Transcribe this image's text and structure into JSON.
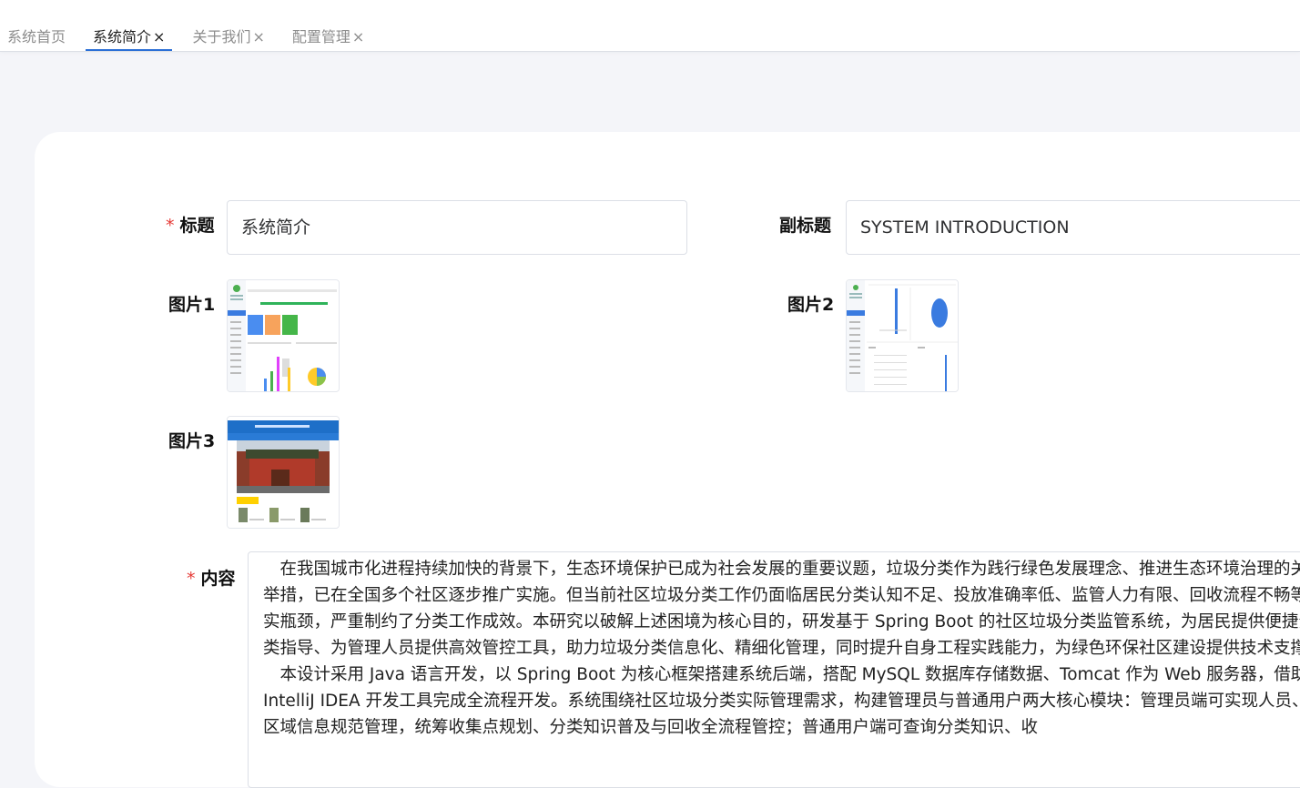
{
  "tabs": [
    {
      "label": "系统首页",
      "close": ""
    },
    {
      "label": "系统简介",
      "close": "×"
    },
    {
      "label": "关于我们",
      "close": "×"
    },
    {
      "label": "配置管理",
      "close": "×"
    }
  ],
  "form": {
    "required_mark": "*",
    "title_label": "标题",
    "title_value": "系统简介",
    "subtitle_label": "副标题",
    "subtitle_value": "SYSTEM INTRODUCTION",
    "image1_label": "图片1",
    "image2_label": "图片2",
    "image3_label": "图片3",
    "content_label": "内容",
    "content_paragraphs": [
      "在我国城市化进程持续加快的背景下，生态环境保护已成为社会发展的重要议题，垃圾分类作为践行绿色发展理念、推进生态环境治理的关键举措，已在全国多个社区逐步推广实施。但当前社区垃圾分类工作仍面临居民分类认知不足、投放准确率低、监管人力有限、回收流程不畅等现实瓶颈，严重制约了分类工作成效。本研究以破解上述困境为核心目的，研发基于 Spring Boot 的社区垃圾分类监管系统，为居民提供便捷分类指导、为管理人员提供高效管控工具，助力垃圾分类信息化、精细化管理，同时提升自身工程实践能力，为绿色环保社区建设提供技术支撑。",
      "本设计采用 Java 语言开发，以 Spring Boot 为核心框架搭建系统后端，搭配 MySQL 数据库存储数据、Tomcat 作为 Web 服务器，借助 IntelliJ IDEA 开发工具完成全流程开发。系统围绕社区垃圾分类实际管理需求，构建管理员与普通用户两大核心模块：管理员端可实现人员、区域信息规范管理，统筹收集点规划、分类知识普及与回收全流程管控；普通用户端可查询分类知识、收"
    ]
  },
  "colors": {
    "active_tab_underline": "#2b6fd6",
    "required": "#e53935",
    "page_bg": "#f4f5f9"
  }
}
